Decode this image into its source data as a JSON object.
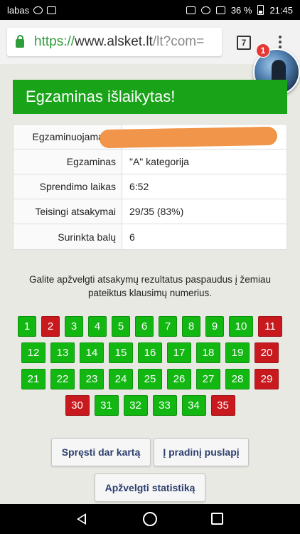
{
  "statusbar": {
    "carrier": "labas",
    "battery": "36 %",
    "time": "21:45"
  },
  "browser": {
    "url_scheme": "https://",
    "url_host": "www.alsket.lt",
    "url_path": "/lt?com=",
    "tab_count": "7"
  },
  "notification_badge": "1",
  "banner": {
    "title": "Egzaminas išlaikytas!"
  },
  "results": [
    {
      "key": "Egzaminuojamasis",
      "value": ""
    },
    {
      "key": "Egzaminas",
      "value": "\"A\" kategorija"
    },
    {
      "key": "Sprendimo laikas",
      "value": "6:52"
    },
    {
      "key": "Teisingi atsakymai",
      "value": "29/35 (83%)"
    },
    {
      "key": "Surinkta balų",
      "value": "6"
    }
  ],
  "info_text": "Galite apžvelgti atsakymų rezultatus paspaudus į žemiau pateiktus klausimų numerius.",
  "questions": {
    "row1": [
      "1",
      "2",
      "3",
      "4",
      "5",
      "6",
      "7",
      "8",
      "9",
      "10",
      "11"
    ],
    "row2": [
      "12",
      "13",
      "14",
      "15",
      "16",
      "17",
      "18",
      "19",
      "20"
    ],
    "row3": [
      "21",
      "22",
      "23",
      "24",
      "25",
      "26",
      "27",
      "28",
      "29"
    ],
    "row4": [
      "30",
      "31",
      "32",
      "33",
      "34",
      "35"
    ],
    "wrong": [
      "2",
      "11",
      "20",
      "29",
      "30",
      "35"
    ]
  },
  "buttons": {
    "retry": "Spręsti dar kartą",
    "home": "Į pradinį puslapį",
    "stats": "Apžvelgti statistiką"
  },
  "colors": {
    "correct": "#12b712",
    "wrong": "#c8191e",
    "banner": "#19a319"
  }
}
